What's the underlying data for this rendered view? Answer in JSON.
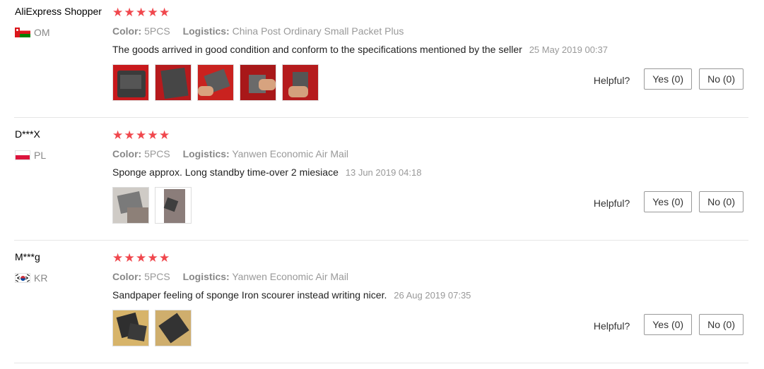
{
  "reviews": [
    {
      "user": "AliExpress Shopper",
      "country_code": "OM",
      "flag_icon": "oman-flag-icon",
      "rating": 5,
      "attrs": {
        "color_label": "Color:",
        "color_value": "5PCS",
        "logistics_label": "Logistics:",
        "logistics_value": "China Post Ordinary Small Packet Plus"
      },
      "text": "The goods arrived in good condition and conform to the specifications mentioned by the seller",
      "date": "25 May 2019 00:37",
      "photo_count": 5,
      "helpful_label": "Helpful?",
      "yes_label": "Yes (0)",
      "no_label": "No (0)"
    },
    {
      "user": "D***X",
      "country_code": "PL",
      "flag_icon": "poland-flag-icon",
      "rating": 5,
      "attrs": {
        "color_label": "Color:",
        "color_value": "5PCS",
        "logistics_label": "Logistics:",
        "logistics_value": "Yanwen Economic Air Mail"
      },
      "text": "Sponge approx. Long standby time-over 2 miesiace",
      "date": "13 Jun 2019 04:18",
      "photo_count": 2,
      "helpful_label": "Helpful?",
      "yes_label": "Yes (0)",
      "no_label": "No (0)"
    },
    {
      "user": "M***g",
      "country_code": "KR",
      "flag_icon": "south-korea-flag-icon",
      "rating": 5,
      "attrs": {
        "color_label": "Color:",
        "color_value": "5PCS",
        "logistics_label": "Logistics:",
        "logistics_value": "Yanwen Economic Air Mail"
      },
      "text": "Sandpaper feeling of sponge Iron scourer instead writing nicer.",
      "date": "26 Aug 2019 07:35",
      "photo_count": 2,
      "helpful_label": "Helpful?",
      "yes_label": "Yes (0)",
      "no_label": "No (0)"
    }
  ],
  "colors": {
    "star": "#f0474d",
    "muted_text": "#999999",
    "divider": "#e6e6e6"
  }
}
